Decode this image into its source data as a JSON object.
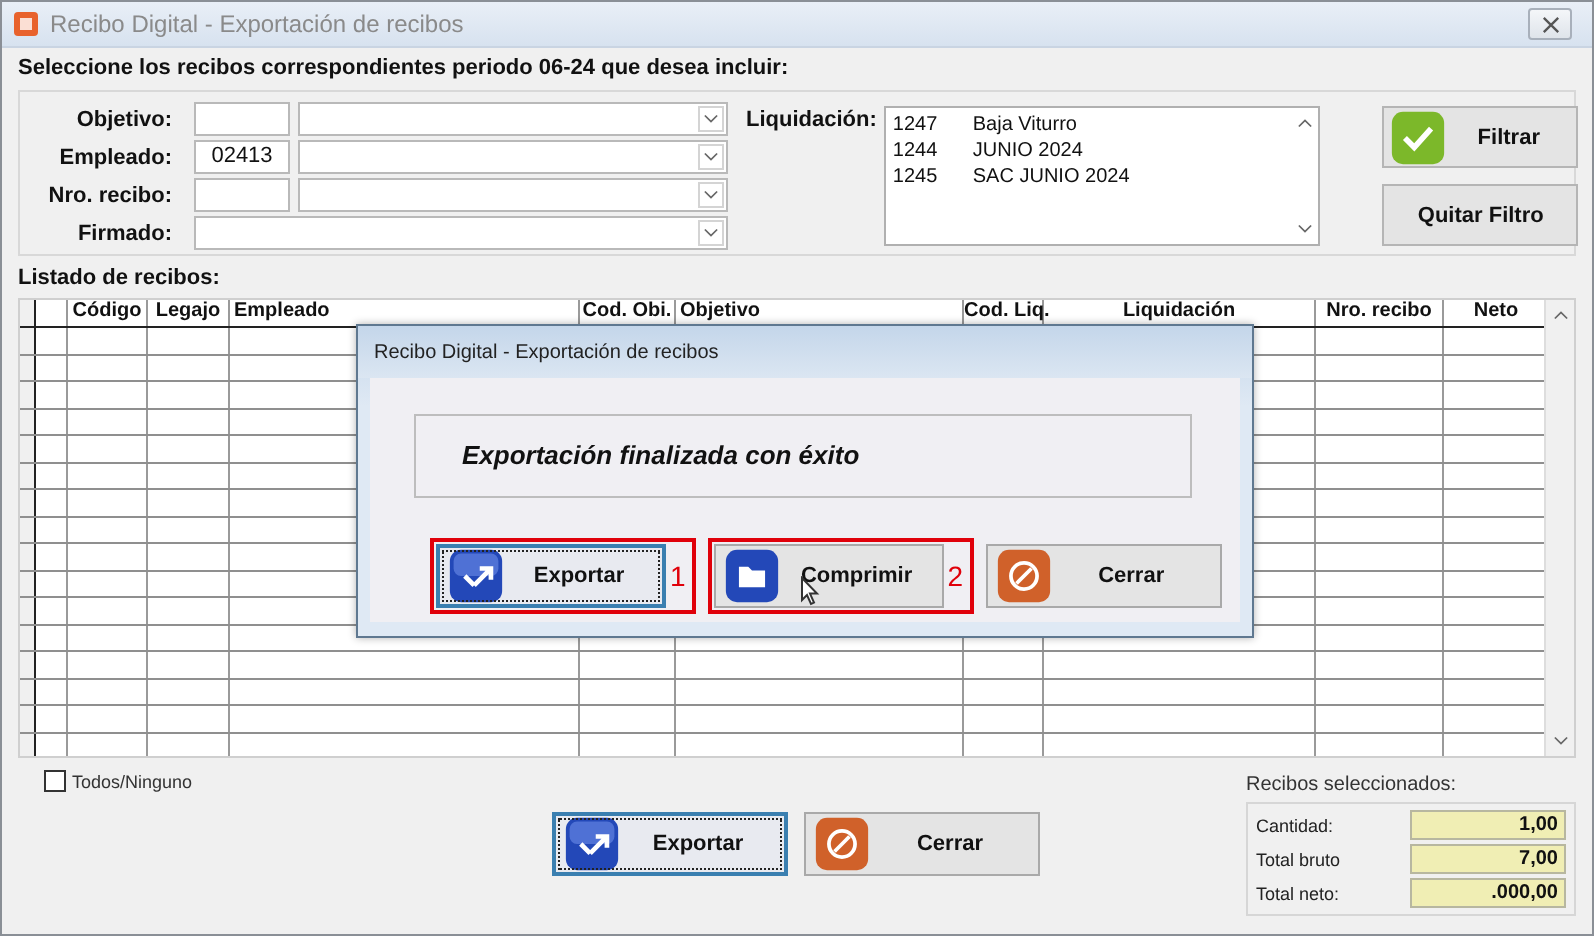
{
  "window": {
    "title": "Recibo Digital - Exportación de recibos"
  },
  "prompt": "Seleccione los recibos correspondientes periodo 06-24 que desea incluir:",
  "filters": [
    {
      "label": "Objetivo:",
      "kind": "code-combo"
    },
    {
      "label": "Empleado:",
      "kind": "code-combo",
      "code": "02413"
    },
    {
      "label": "Nro. recibo:",
      "kind": "code-combo"
    },
    {
      "label": "Firmado:",
      "kind": "combo"
    }
  ],
  "liquidacion": {
    "label": "Liquidación:",
    "items": [
      {
        "code": "1247",
        "name": "Baja Viturro",
        "selected": false
      },
      {
        "code": "1244",
        "name": "JUNIO 2024",
        "selected": false
      },
      {
        "code": "1245",
        "name": "SAC JUNIO 2024",
        "selected": false
      }
    ]
  },
  "filter_buttons": [
    {
      "label": "Filtrar",
      "kind": "check"
    },
    {
      "label": "Quitar Filtro",
      "kind": "plain"
    }
  ],
  "list": {
    "title": "Listado de recibos:",
    "columns": [
      "Código",
      "Legajo",
      "Empleado",
      "Cod. Obi.",
      "Objetivo",
      "Cod. Liq.",
      "Liquidación",
      "Nro. recibo",
      "Neto"
    ]
  },
  "select_all": {
    "label": "Todos/Ninguno",
    "checked": false
  },
  "actions": [
    {
      "label": "Exportar",
      "kind": "export",
      "focused": true
    },
    {
      "label": "Cerrar",
      "kind": "close",
      "focused": false
    }
  ],
  "summary": {
    "title": "Recibos seleccionados:",
    "rows": [
      {
        "label": "Cantidad:",
        "value": "1,00"
      },
      {
        "label": "Total bruto",
        "value": "7,00"
      },
      {
        "label": "Total neto:",
        "value": ".000,00"
      }
    ]
  },
  "dialog": {
    "title": "Recibo Digital - Exportación de recibos",
    "message": "Exportación finalizada con éxito",
    "buttons": [
      {
        "label": "Exportar",
        "kind": "export",
        "focused": true,
        "annotation": "1"
      },
      {
        "label": "Comprimir",
        "kind": "folder",
        "focused": false,
        "annotation": "2"
      },
      {
        "label": "Cerrar",
        "kind": "close",
        "focused": false
      }
    ]
  }
}
